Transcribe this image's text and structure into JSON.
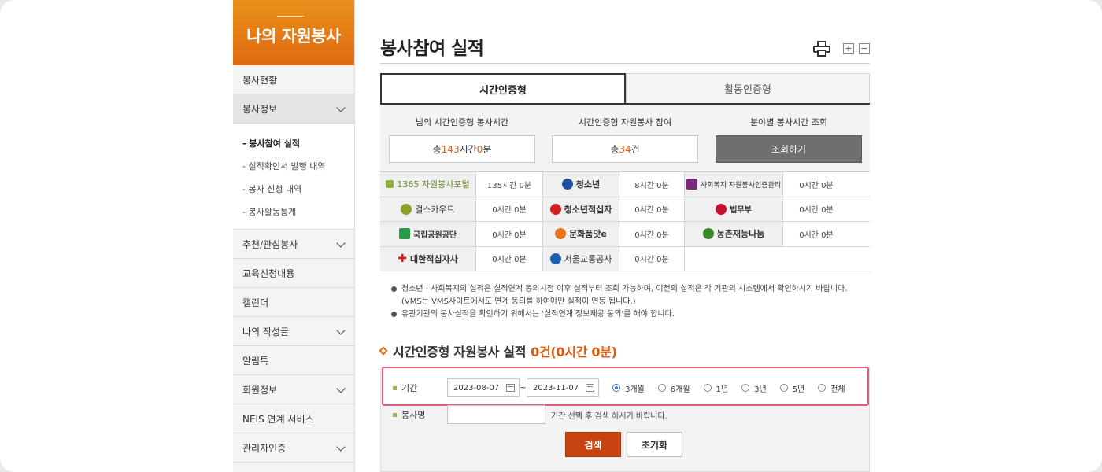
{
  "sidebar": {
    "title": "나의 자원봉사",
    "menu": [
      {
        "label": "봉사현황",
        "expandable": false
      },
      {
        "label": "봉사정보",
        "expandable": true,
        "active": true
      }
    ],
    "submenu": [
      {
        "label": "- 봉사참여 실적",
        "current": true
      },
      {
        "label": "- 실적확인서 발행 내역"
      },
      {
        "label": "- 봉사 신청 내역"
      },
      {
        "label": "- 봉사활동통계"
      }
    ],
    "menu2": [
      {
        "label": "추천/관심봉사",
        "expandable": true
      },
      {
        "label": "교육신청내용",
        "expandable": false
      },
      {
        "label": "캘린더",
        "expandable": false
      },
      {
        "label": "나의 작성글",
        "expandable": true
      },
      {
        "label": "알림톡",
        "expandable": false
      },
      {
        "label": "회원정보",
        "expandable": true
      },
      {
        "label": "NEIS 연계 서비스",
        "expandable": false
      },
      {
        "label": "관리자인증",
        "expandable": true
      }
    ]
  },
  "page": {
    "title": "봉사참여 실적",
    "zoom_in": "+",
    "zoom_out": "−"
  },
  "tabs": [
    {
      "label": "시간인증형",
      "active": true
    },
    {
      "label": "활동인증형",
      "active": false
    }
  ],
  "stats": {
    "col1_label": "님의 시간인증형 봉사시간",
    "col1_prefix": "총 ",
    "col1_hours": "143",
    "col1_mid": "시간 ",
    "col1_minutes": "0",
    "col1_suffix": "분",
    "col2_label": "시간인증형 자원봉사 참여",
    "col2_prefix": "총 ",
    "col2_count": "34",
    "col2_suffix": "건",
    "col3_label": "분야별 봉사시간 조회",
    "col3_button": "조회하기"
  },
  "orgs": [
    [
      {
        "name": "1365 자원봉사포털",
        "value": "135시간 0분",
        "color": "#8fb33a"
      },
      {
        "name": "청소년",
        "value": "8시간 0분",
        "color": "#1f4fa0"
      },
      {
        "name": "사회복지 자원봉사인증관리",
        "value": "0시간 0분",
        "color": "#7a2a7a"
      }
    ],
    [
      {
        "name": "걸스카우트",
        "value": "0시간 0분",
        "color": "#8aa22a"
      },
      {
        "name": "청소년적십자",
        "value": "0시간 0분",
        "color": "#d21f26"
      },
      {
        "name": "법무부",
        "value": "0시간 0분",
        "color": "#c8102e"
      }
    ],
    [
      {
        "name": "국립공원공단",
        "value": "0시간 0분",
        "color": "#2a9a4a"
      },
      {
        "name": "문화품앗e",
        "value": "0시간 0분",
        "color": "#e8731a"
      },
      {
        "name": "농촌재능나눔",
        "value": "0시간 0분",
        "color": "#3a8a2a"
      }
    ],
    [
      {
        "name": "대한적십자사",
        "value": "0시간 0분",
        "color": "#d21f26"
      },
      {
        "name": "서울교통공사",
        "value": "0시간 0분",
        "color": "#1a5fb0"
      }
    ]
  ],
  "notes": {
    "n1_line1": "청소년 · 사회복지의 실적은 실적연계 동의시점 이후 실적부터 조회 가능하며, 이전의 실적은 각 기관의 시스템에서 확인하시기 바랍니다.",
    "n1_line2": "(VMS는 VMS사이트에서도 연계 동의를 하여야만 실적이 연동 됩니다.)",
    "n2": "유관기관의 봉사실적을 확인하기 위해서는 '실적연계 정보제공 동의'를 해야 합니다."
  },
  "section": {
    "title": "시간인증형 자원봉사 실적 ",
    "summary": "0건(0시간 0분)"
  },
  "search": {
    "period_label": "기간",
    "date_from": "2023-08-07",
    "tilde": "~",
    "date_to": "2023-11-07",
    "radios": [
      {
        "label": "3개월",
        "checked": true
      },
      {
        "label": "6개월",
        "checked": false
      },
      {
        "label": "1년",
        "checked": false
      },
      {
        "label": "3년",
        "checked": false
      },
      {
        "label": "5년",
        "checked": false
      },
      {
        "label": "전체",
        "checked": false
      }
    ],
    "name_label": "봉사명",
    "name_value": "",
    "hint": "기간 선택 후 검색 하시기 바랍니다.",
    "search_button": "검색",
    "reset_button": "초기화"
  },
  "colors": {
    "accent": "#e05a0a",
    "header_orange": "#e06a10",
    "highlight_border": "#e35d78",
    "search_button": "#c74310"
  }
}
